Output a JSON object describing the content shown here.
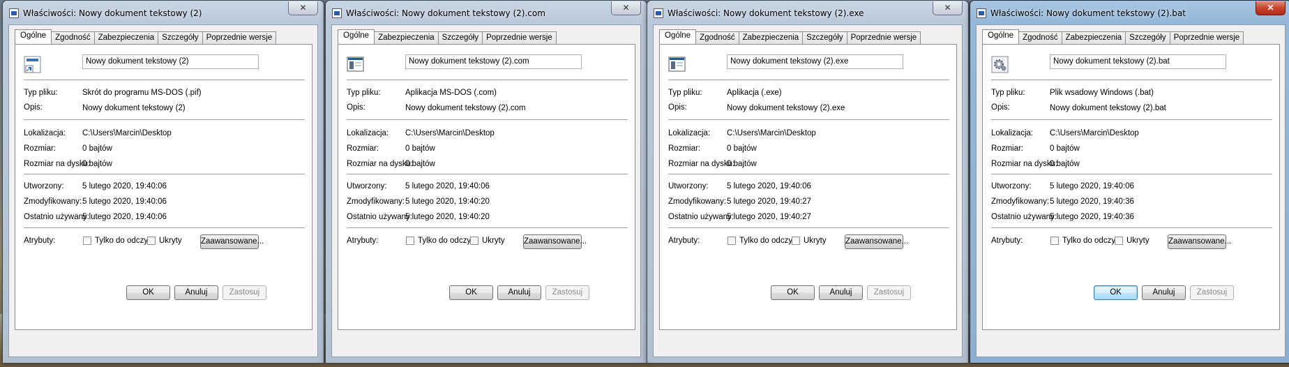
{
  "labels": {
    "type": "Typ pliku:",
    "description": "Opis:",
    "location": "Lokalizacja:",
    "size": "Rozmiar:",
    "size_on_disk": "Rozmiar na dysku:",
    "created": "Utworzony:",
    "modified": "Zmodyfikowany:",
    "accessed": "Ostatnio używany:",
    "attributes": "Atrybuty:",
    "readonly": "Tylko do odczytu",
    "hidden": "Ukryty",
    "advanced": "Zaawansowane...",
    "ok": "OK",
    "cancel": "Anuluj",
    "apply": "Zastosuj",
    "close_glyph": "✕"
  },
  "windows": [
    {
      "title": "Właściwości: Nowy dokument tekstowy (2)",
      "active": false,
      "tabs": [
        "Ogólne",
        "Zgodność",
        "Zabezpieczenia",
        "Szczegóły",
        "Poprzednie wersje"
      ],
      "selected_tab": 0,
      "icon": "shortcut-icon",
      "name": "Nowy dokument tekstowy (2)",
      "type": "Skrót do programu MS-DOS (.pif)",
      "description": "Nowy dokument tekstowy (2)",
      "location": "C:\\Users\\Marcin\\Desktop",
      "size": "0 bajtów",
      "size_on_disk": "0 bajtów",
      "created": "5 lutego 2020, 19:40:06",
      "modified": "5 lutego 2020, 19:40:06",
      "accessed": "5 lutego 2020, 19:40:06",
      "readonly": false,
      "hidden": false
    },
    {
      "title": "Właściwości: Nowy dokument tekstowy (2).com",
      "active": false,
      "tabs": [
        "Ogólne",
        "Zabezpieczenia",
        "Szczegóły",
        "Poprzednie wersje"
      ],
      "selected_tab": 0,
      "icon": "application-window-icon",
      "name": "Nowy dokument tekstowy (2).com",
      "type": "Aplikacja MS-DOS (.com)",
      "description": "Nowy dokument tekstowy (2).com",
      "location": "C:\\Users\\Marcin\\Desktop",
      "size": "0 bajtów",
      "size_on_disk": "0 bajtów",
      "created": "5 lutego 2020, 19:40:06",
      "modified": "5 lutego 2020, 19:40:20",
      "accessed": "5 lutego 2020, 19:40:20",
      "readonly": false,
      "hidden": false
    },
    {
      "title": "Właściwości: Nowy dokument tekstowy (2).exe",
      "active": false,
      "tabs": [
        "Ogólne",
        "Zgodność",
        "Zabezpieczenia",
        "Szczegóły",
        "Poprzednie wersje"
      ],
      "selected_tab": 0,
      "icon": "application-window-icon",
      "name": "Nowy dokument tekstowy (2).exe",
      "type": "Aplikacja (.exe)",
      "description": "Nowy dokument tekstowy (2).exe",
      "location": "C:\\Users\\Marcin\\Desktop",
      "size": "0 bajtów",
      "size_on_disk": "0 bajtów",
      "created": "5 lutego 2020, 19:40:06",
      "modified": "5 lutego 2020, 19:40:27",
      "accessed": "5 lutego 2020, 19:40:27",
      "readonly": false,
      "hidden": false
    },
    {
      "title": "Właściwości: Nowy dokument tekstowy (2).bat",
      "active": true,
      "tabs": [
        "Ogólne",
        "Zgodność",
        "Zabezpieczenia",
        "Szczegóły",
        "Poprzednie wersje"
      ],
      "selected_tab": 0,
      "icon": "batch-gear-icon",
      "name": "Nowy dokument tekstowy (2).bat",
      "type": "Plik wsadowy Windows (.bat)",
      "description": "Nowy dokument tekstowy (2).bat",
      "location": "C:\\Users\\Marcin\\Desktop",
      "size": "0 bajtów",
      "size_on_disk": "0 bajtów",
      "created": "5 lutego 2020, 19:40:06",
      "modified": "5 lutego 2020, 19:40:36",
      "accessed": "5 lutego 2020, 19:40:36",
      "readonly": false,
      "hidden": false
    }
  ]
}
